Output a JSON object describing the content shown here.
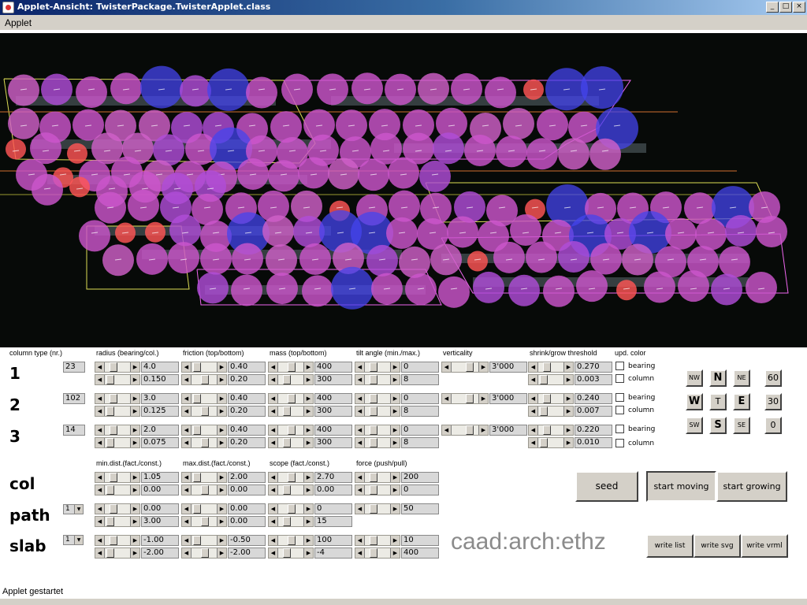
{
  "window": {
    "title": "Applet-Ansicht: TwisterPackage.TwisterApplet.class",
    "min": "_",
    "max": "□",
    "close": "×"
  },
  "menu": {
    "applet": "Applet"
  },
  "headers": {
    "column_type": "column type (nr.)",
    "radius": "radius (bearing/col.)",
    "friction": "friction (top/bottom)",
    "mass": "mass (top/bottom)",
    "tilt": "tilt angle (min./max.)",
    "verticality": "verticality",
    "shrink": "shrink/grow threshold",
    "upd_color": "upd. color",
    "min_dist": "min.dist.(fact./const.)",
    "max_dist": "max.dist.(fact./const.)",
    "scope": "scope (fact./const.)",
    "force": "force (push/pull)"
  },
  "rows": [
    {
      "label": "1",
      "type_nr": "23",
      "radius": [
        "4.0",
        "0.150"
      ],
      "friction": [
        "0.40",
        "0.20"
      ],
      "mass": [
        "400",
        "300"
      ],
      "tilt": [
        "0",
        "8"
      ],
      "verticality": "3'000",
      "shrink": [
        "0.270",
        "0.003"
      ],
      "bearing": "bearing",
      "column": "column"
    },
    {
      "label": "2",
      "type_nr": "102",
      "radius": [
        "3.0",
        "0.125"
      ],
      "friction": [
        "0.40",
        "0.20"
      ],
      "mass": [
        "400",
        "300"
      ],
      "tilt": [
        "0",
        "8"
      ],
      "verticality": "3'000",
      "shrink": [
        "0.240",
        "0.007"
      ],
      "bearing": "bearing",
      "column": "column"
    },
    {
      "label": "3",
      "type_nr": "14",
      "radius": [
        "2.0",
        "0.075"
      ],
      "friction": [
        "0.40",
        "0.20"
      ],
      "mass": [
        "400",
        "300"
      ],
      "tilt": [
        "0",
        "8"
      ],
      "verticality": "3'000",
      "shrink": [
        "0.220",
        "0.010"
      ],
      "bearing": "bearing",
      "column": "column"
    }
  ],
  "lower": {
    "col": {
      "label": "col",
      "min_dist": [
        "1.05",
        "0.00"
      ],
      "max_dist": [
        "2.00",
        "0.00"
      ],
      "scope": [
        "2.70",
        "0.00"
      ],
      "force": [
        "200",
        "0"
      ]
    },
    "path": {
      "label": "path",
      "select": "1",
      "min_dist": [
        "0.00",
        "3.00"
      ],
      "max_dist": [
        "0.00",
        "0.00"
      ],
      "scope": [
        "0",
        "15"
      ],
      "force": [
        "50"
      ]
    },
    "slab": {
      "label": "slab",
      "select": "1",
      "min_dist": [
        "-1.00",
        "-2.00"
      ],
      "max_dist": [
        "-0.50",
        "-2.00"
      ],
      "scope": [
        "100",
        "-4"
      ],
      "force": [
        "10",
        "400"
      ]
    }
  },
  "directions": {
    "nw": "NW",
    "n": "N",
    "ne": "NE",
    "w": "W",
    "t": "T",
    "e": "E",
    "sw": "SW",
    "s": "S",
    "se": "SE"
  },
  "numbers": [
    "60",
    "30",
    "0"
  ],
  "buttons": {
    "seed": "seed",
    "start_moving": "start moving",
    "start_growing": "start growing",
    "write_list": "write list",
    "write_svg": "write svg",
    "write_vrml": "write vrml"
  },
  "logo": "caad:arch:ethz",
  "status": "Applet gestartet"
}
